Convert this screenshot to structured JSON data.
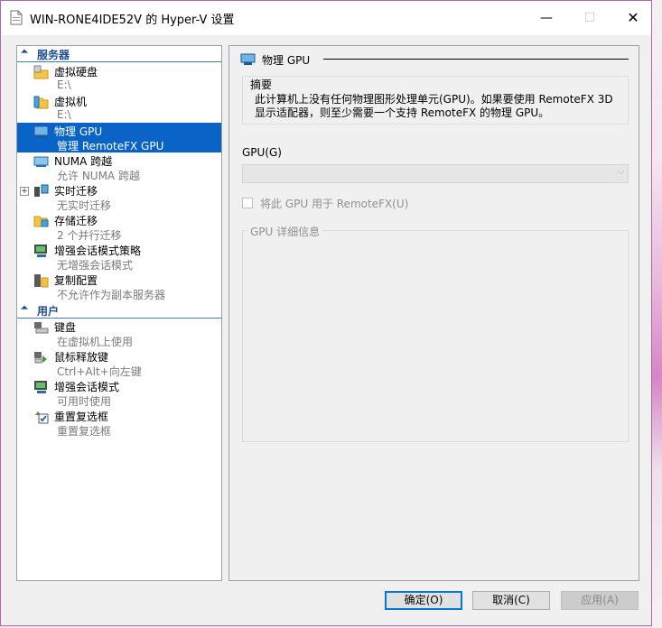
{
  "window": {
    "title": "WIN-RONE4IDE52V 的 Hyper-V 设置",
    "controls": {
      "minimize": "—",
      "maximize": "☐",
      "close": "✕"
    }
  },
  "tree": {
    "sections": [
      {
        "label": "服务器",
        "chevron": "⏶"
      },
      {
        "label": "用户",
        "chevron": "⏶"
      }
    ],
    "server_items": [
      {
        "title": "虚拟硬盘",
        "subtitle": "E:\\",
        "icon": "folder-disk-icon"
      },
      {
        "title": "虚拟机",
        "subtitle": "E:\\",
        "icon": "folder-vm-icon"
      },
      {
        "title": "物理 GPU",
        "subtitle": "管理 RemoteFX GPU",
        "icon": "gpu-icon",
        "selected": true
      },
      {
        "title": "NUMA 跨越",
        "subtitle": "允许 NUMA 跨越",
        "icon": "numa-icon"
      },
      {
        "title": "实时迁移",
        "subtitle": "无实时迁移",
        "icon": "live-migration-icon",
        "expandable": true
      },
      {
        "title": "存储迁移",
        "subtitle": "2 个并行迁移",
        "icon": "storage-migration-icon"
      },
      {
        "title": "增强会话模式策略",
        "subtitle": "无增强会话模式",
        "icon": "enhanced-session-policy-icon"
      },
      {
        "title": "复制配置",
        "subtitle": "不允许作为副本服务器",
        "icon": "replication-icon"
      }
    ],
    "user_items": [
      {
        "title": "键盘",
        "subtitle": "在虚拟机上使用",
        "icon": "keyboard-icon"
      },
      {
        "title": "鼠标释放键",
        "subtitle": "Ctrl+Alt+向左键",
        "icon": "mouse-release-icon"
      },
      {
        "title": "增强会话模式",
        "subtitle": "可用时使用",
        "icon": "enhanced-session-icon"
      },
      {
        "title": "重置复选框",
        "subtitle": "重置复选框",
        "icon": "reset-checkbox-icon"
      }
    ]
  },
  "content": {
    "heading": "物理 GPU",
    "summary_title": "摘要",
    "summary_text": "此计算机上没有任何物理图形处理单元(GPU)。如果要使用 RemoteFX 3D 显示适配器，则至少需要一个支持 RemoteFX 的物理 GPU。",
    "gpu_label": "GPU(G)",
    "gpu_selected": "",
    "checkbox_label": "将此 GPU 用于 RemoteFX(U)",
    "checkbox_checked": false,
    "details_title": "GPU 详细信息"
  },
  "buttons": {
    "ok": "确定(O)",
    "cancel": "取消(C)",
    "apply": "应用(A)"
  },
  "colors": {
    "selection": "#0a64c8",
    "section_header": "#1e4e8c",
    "window_border": "#b3679f"
  }
}
